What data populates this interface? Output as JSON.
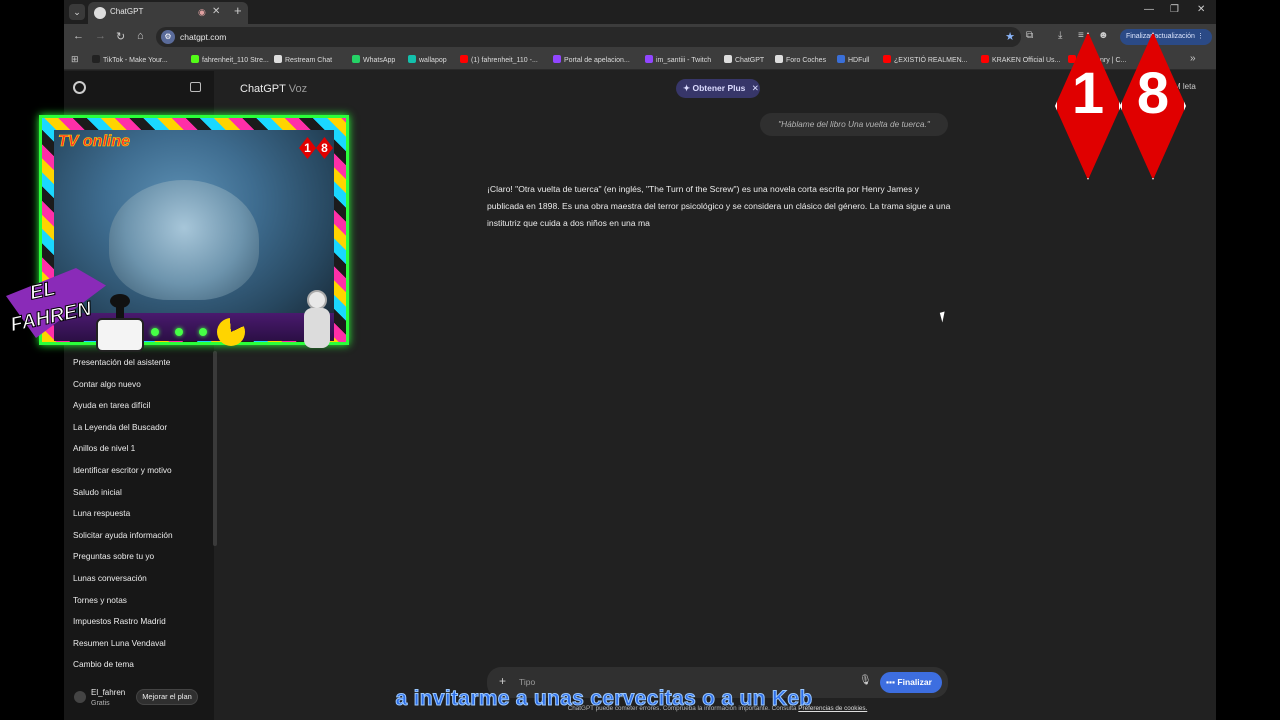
{
  "browser": {
    "tab_title": "ChatGPT",
    "url": "chatgpt.com",
    "update_button": "Finalizar actualización",
    "bookmarks": [
      "TikTok - Make Your...",
      "fahrenheit_110 Stre...",
      "Restream Chat",
      "WhatsApp",
      "wallapop",
      "(1) fahrenheit_110 -...",
      "Portal de apelacion...",
      "im_santiii - Twitch",
      "ChatGPT",
      "Foro Coches",
      "HDFull",
      "¿EXISTIÓ REALMEN...",
      "KRAKEN Official Us...",
      "ore Henry | C..."
    ],
    "bookmark_colors": [
      "#222",
      "#53fc18",
      "#ddd",
      "#25d366",
      "#13c1ac",
      "#ff0000",
      "#9146ff",
      "#9146ff",
      "#ddd",
      "#ddd",
      "#3a6fd8",
      "#ff0000",
      "#ff0000",
      "#ff0000"
    ]
  },
  "sidebar": {
    "items": [
      "Presentación del asistente",
      "Contar algo nuevo",
      "Ayuda en tarea difícil",
      "La Leyenda del Buscador",
      "Anillos de nivel 1",
      "Identificar escritor y motivo",
      "Saludo inicial",
      "Luna respuesta",
      "Solicitar ayuda información",
      "Preguntas sobre tu yo",
      "Lunas conversación",
      "Tornes y notas",
      "Impuestos Rastro Madrid",
      "Resumen Luna Vendaval",
      "Cambio de tema"
    ],
    "user_name": "El_fahren",
    "user_plan": "Gratis",
    "upgrade_button": "Mejorar el plan"
  },
  "main": {
    "title": "ChatGPT",
    "title_mode": "Voz",
    "get_plus": "Obtener Plus",
    "right_partial": "M          leta",
    "user_message": "\"Háblame del libro Una vuelta de tuerca.\"",
    "assistant_message": "¡Claro! \"Otra vuelta de tuerca\" (en inglés, \"The Turn of the Screw\") es una novela corta escrita por Henry James y publicada en 1898. Es una obra maestra del terror psicológico y se considera un clásico del género. La trama sigue a una institutriz que cuida a dos niños en una ma",
    "composer_placeholder": "Tipo",
    "finalize_button": "Finalizar",
    "disclaimer": "ChatGPT puede cometer errores. Comprueba la información importante. Consulta",
    "disclaimer_link": "Preferencias de cookies."
  },
  "overlay": {
    "caption": "a invitarme a unas cervecitas o a un Keb",
    "tv_label": "TV online",
    "badge_digits": [
      "1",
      "8"
    ],
    "logo_line1": "EL",
    "logo_line2": "FAHREN"
  }
}
